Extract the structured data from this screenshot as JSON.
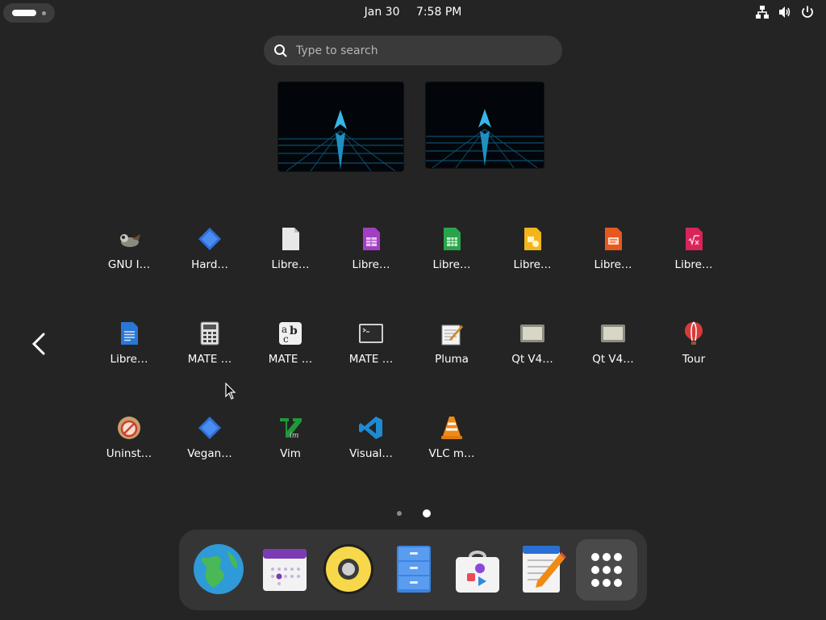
{
  "topbar": {
    "date": "Jan 30",
    "time": "7:58 PM",
    "icons": [
      "network-icon",
      "volume-icon",
      "power-icon"
    ]
  },
  "search": {
    "placeholder": "Type to search",
    "value": ""
  },
  "workspaces": [
    "workspace-1",
    "workspace-2"
  ],
  "apps": [
    {
      "label": "GNU I…",
      "icon": "gimp-icon"
    },
    {
      "label": "Hard…",
      "icon": "hardinfo-icon"
    },
    {
      "label": "Libre…",
      "icon": "libreoffice-icon"
    },
    {
      "label": "Libre…",
      "icon": "libreoffice-base-icon"
    },
    {
      "label": "Libre…",
      "icon": "libreoffice-calc-icon"
    },
    {
      "label": "Libre…",
      "icon": "libreoffice-draw-icon"
    },
    {
      "label": "Libre…",
      "icon": "libreoffice-impress-icon"
    },
    {
      "label": "Libre…",
      "icon": "libreoffice-math-icon"
    },
    {
      "label": "Libre…",
      "icon": "libreoffice-writer-icon"
    },
    {
      "label": "MATE …",
      "icon": "calculator-icon"
    },
    {
      "label": "MATE …",
      "icon": "character-map-icon"
    },
    {
      "label": "MATE …",
      "icon": "terminal-icon"
    },
    {
      "label": "Pluma",
      "icon": "text-editor-icon"
    },
    {
      "label": "Qt V4…",
      "icon": "qt-v4l2-icon"
    },
    {
      "label": "Qt V4…",
      "icon": "qt-v4l2-icon"
    },
    {
      "label": "Tour",
      "icon": "tour-balloon-icon"
    },
    {
      "label": "Uninst…",
      "icon": "uninstall-icon"
    },
    {
      "label": "Vegan…",
      "icon": "vegan-icon"
    },
    {
      "label": "Vim",
      "icon": "vim-icon"
    },
    {
      "label": "Visual…",
      "icon": "vscode-icon"
    },
    {
      "label": "VLC m…",
      "icon": "vlc-icon"
    }
  ],
  "pager": {
    "pages": 2,
    "current": 2
  },
  "dock": [
    "browser-icon",
    "calendar-icon",
    "music-player-icon",
    "file-manager-icon",
    "software-store-icon",
    "text-editor-icon",
    "show-apps-icon"
  ]
}
